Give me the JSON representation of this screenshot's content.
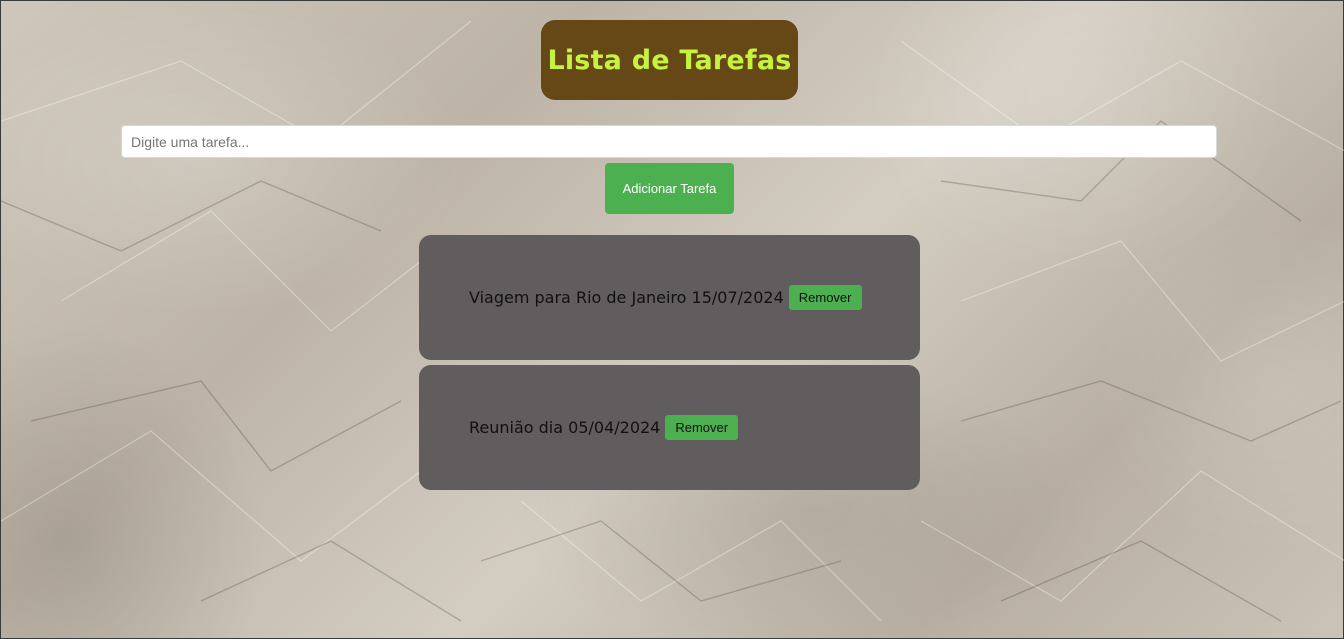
{
  "header": {
    "title": "Lista de Tarefas"
  },
  "form": {
    "input_value": "",
    "input_placeholder": "Digite uma tarefa...",
    "add_label": "Adicionar Tarefa"
  },
  "tasks": [
    {
      "text": "Viagem para Rio de Janeiro 15/07/2024",
      "remove_label": "Remover"
    },
    {
      "text": "Reunião dia 05/04/2024",
      "remove_label": "Remover"
    }
  ],
  "colors": {
    "title_bg": "#664716",
    "title_text": "#c6f33f",
    "accent_green": "#4caf50",
    "task_bg": "#615c5d"
  }
}
